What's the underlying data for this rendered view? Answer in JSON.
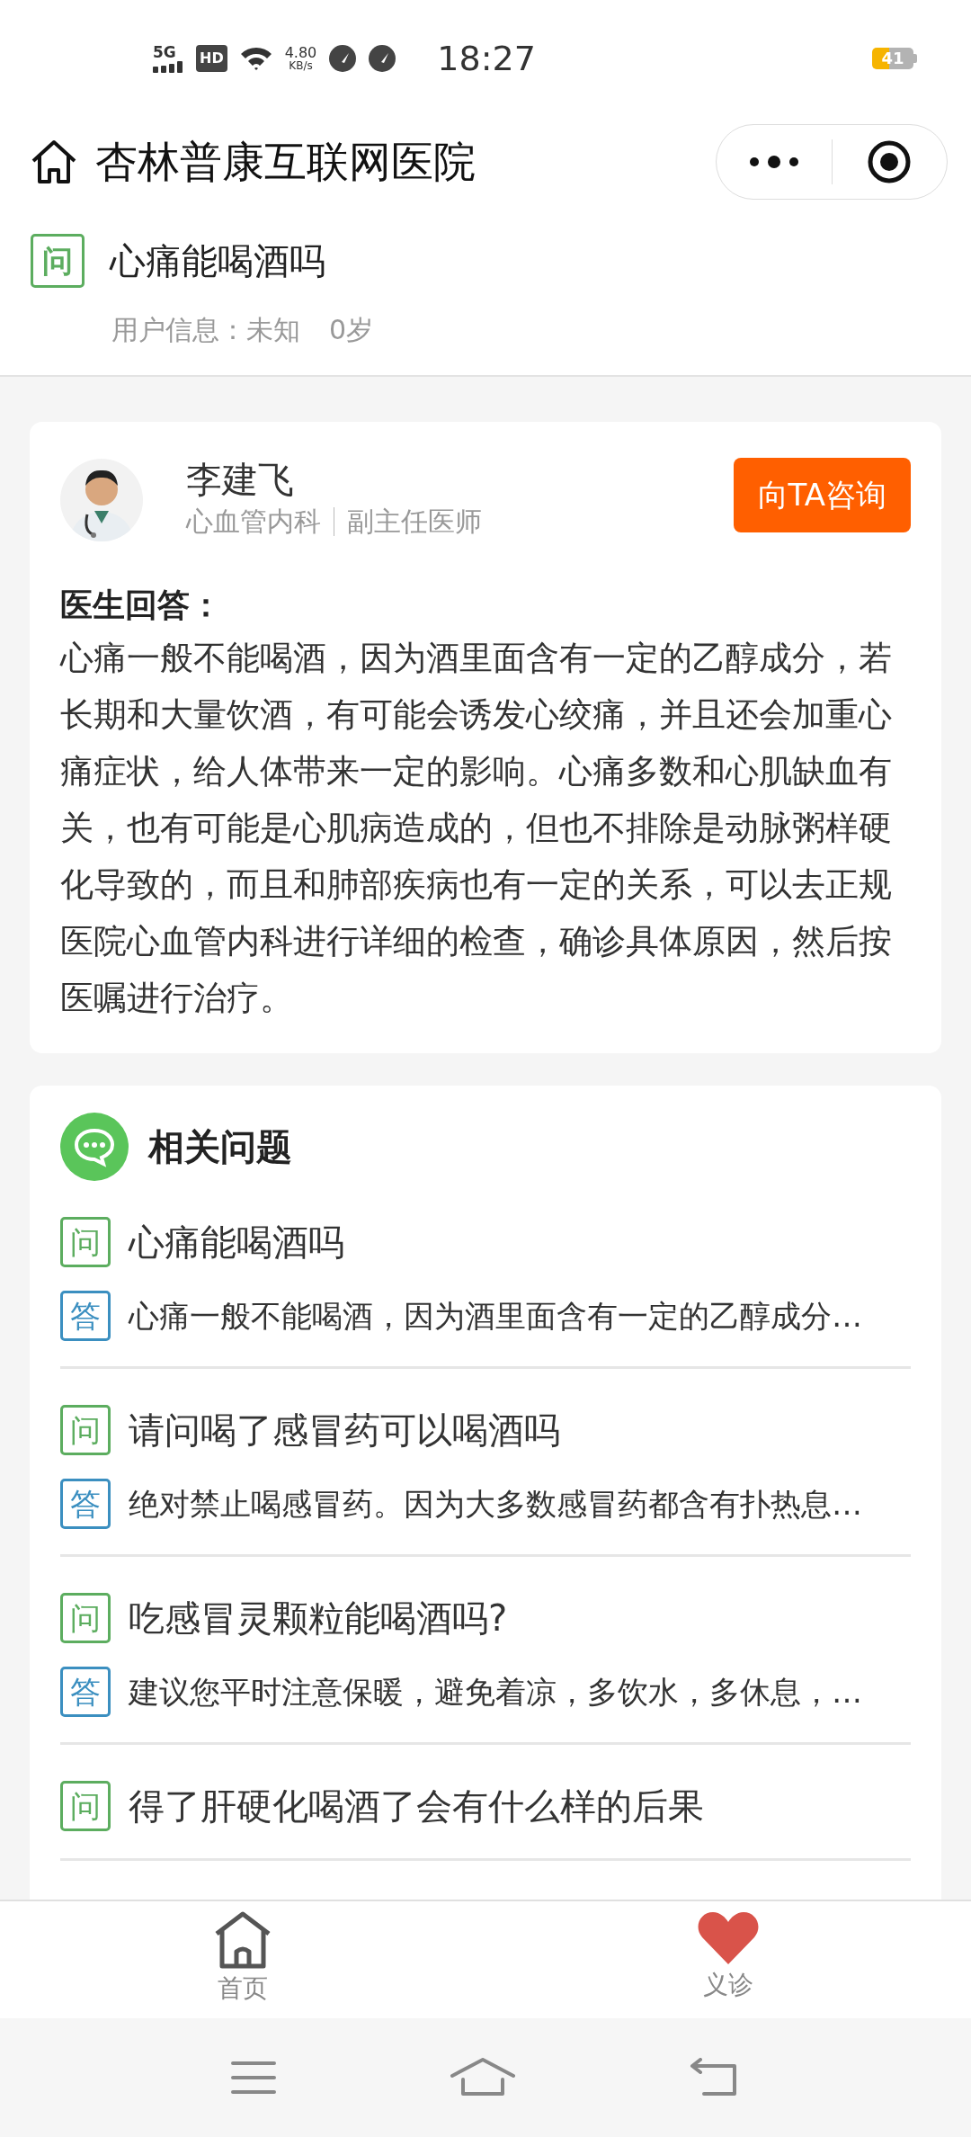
{
  "status_bar": {
    "network": "5G",
    "hd": "HD",
    "speed": "4.80",
    "speed_unit": "KB/s",
    "time": "18:27",
    "battery": "41"
  },
  "header": {
    "title": "杏林普康互联网医院"
  },
  "question": {
    "badge": "问",
    "title": "心痛能喝酒吗",
    "user_info": "用户信息：未知",
    "age": "0岁"
  },
  "doctor": {
    "name": "李建飞",
    "department": "心血管内科",
    "rank": "副主任医师",
    "consult_button": "向TA咨询",
    "answer_label": "医生回答：",
    "answer": "心痛一般不能喝酒，因为酒里面含有一定的乙醇成分，若长期和大量饮酒，有可能会诱发心绞痛，并且还会加重心痛症状，给人体带来一定的影响。心痛多数和心肌缺血有关，也有可能是心肌病造成的，但也不排除是动脉粥样硬化导致的，而且和肺部疾病也有一定的关系，可以去正规医院心血管内科进行详细的检查，确诊具体原因，然后按医嘱进行治疗。"
  },
  "related": {
    "title": "相关问题",
    "items": [
      {
        "q_badge": "问",
        "question": "心痛能喝酒吗",
        "a_badge": "答",
        "answer": "心痛一般不能喝酒，因为酒里面含有一定的乙醇成分…"
      },
      {
        "q_badge": "问",
        "question": "请问喝了感冒药可以喝酒吗",
        "a_badge": "答",
        "answer": "绝对禁止喝感冒药。因为大多数感冒药都含有扑热息…"
      },
      {
        "q_badge": "问",
        "question": "吃感冒灵颗粒能喝酒吗?",
        "a_badge": "答",
        "answer": "建议您平时注意保暖，避免着凉，多饮水，多休息，…"
      },
      {
        "q_badge": "问",
        "question": "得了肝硬化喝酒了会有什么样的后果"
      }
    ]
  },
  "tab_bar": {
    "items": [
      {
        "kind": "home",
        "label": "首页"
      },
      {
        "kind": "heart",
        "label": "义诊"
      }
    ]
  }
}
